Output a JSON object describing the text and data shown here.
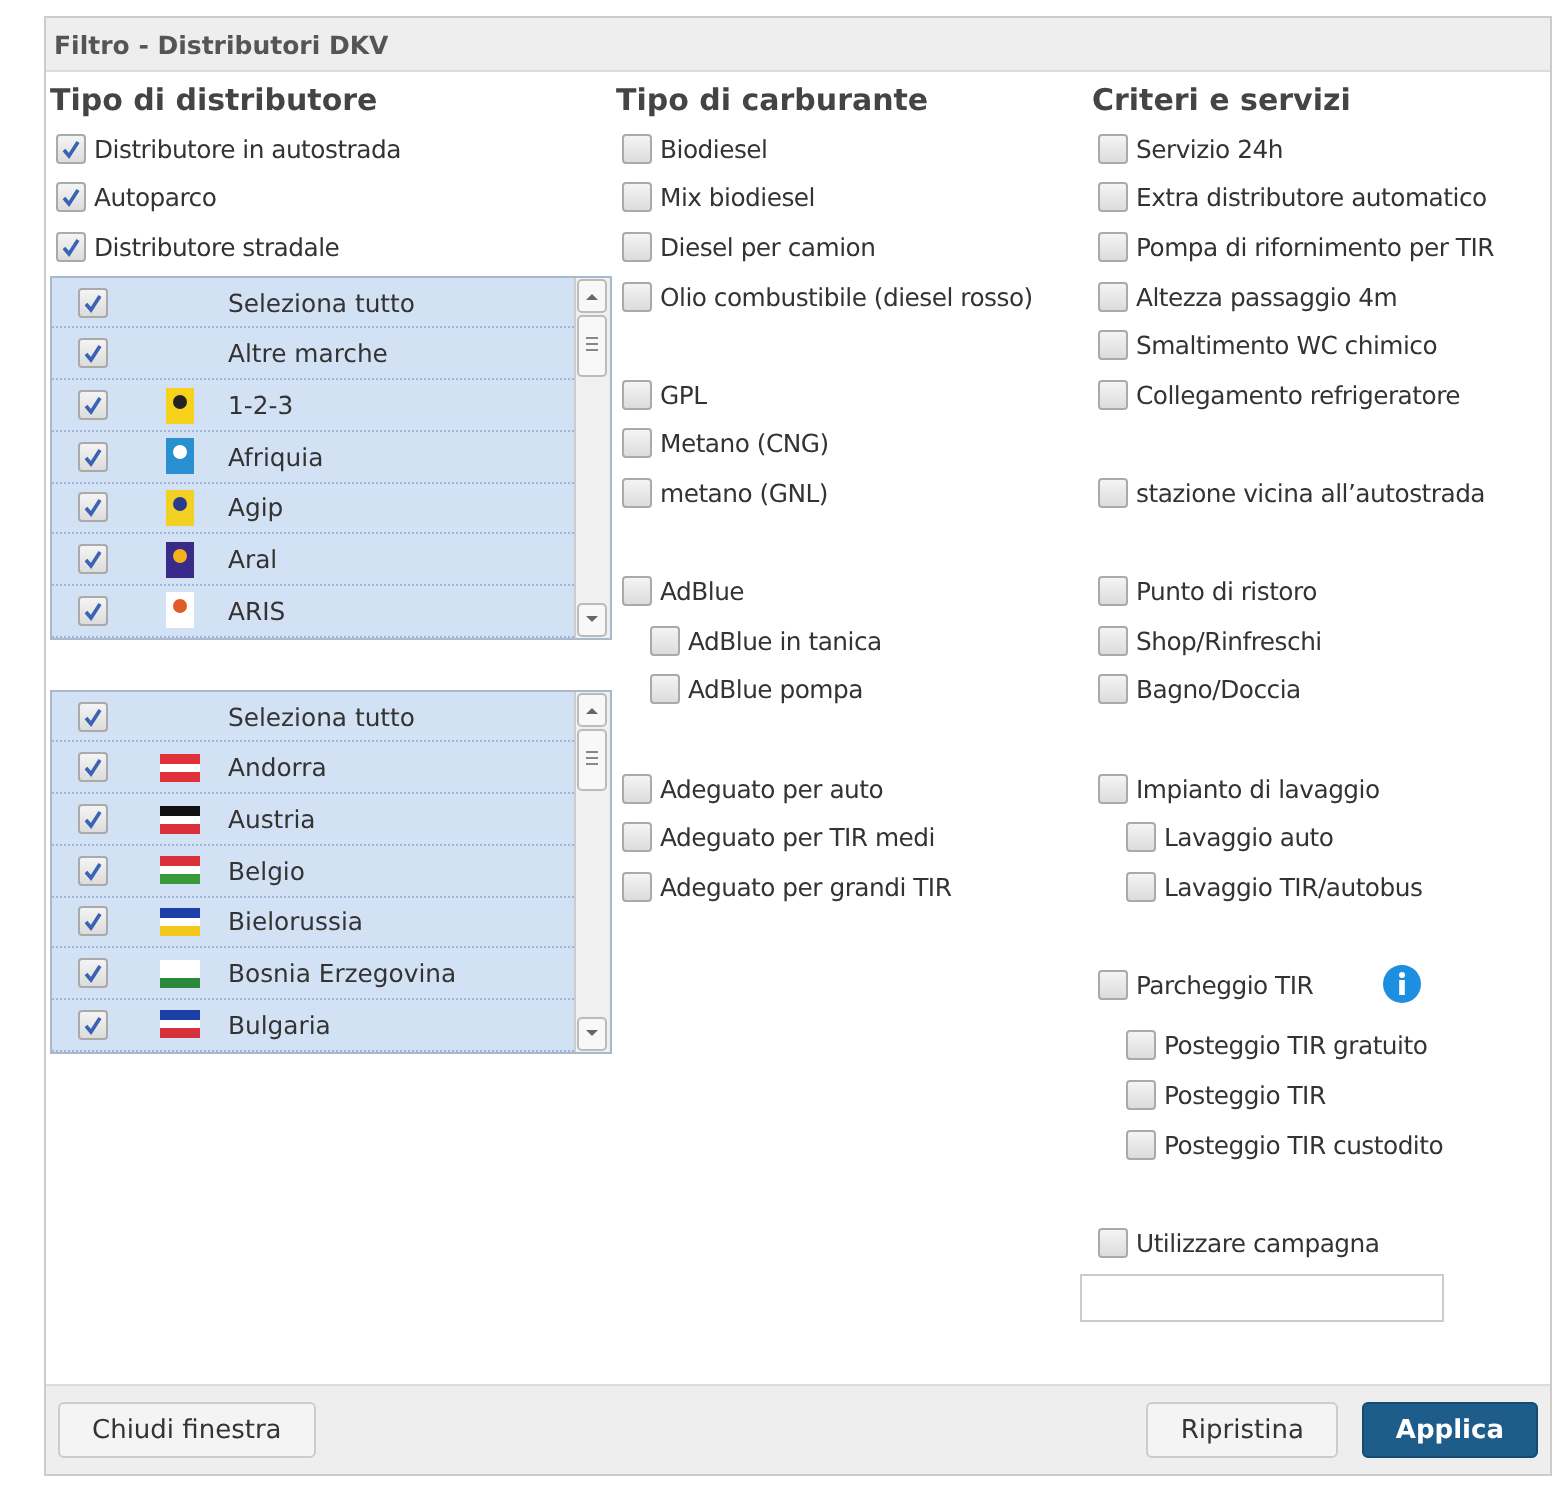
{
  "window": {
    "title": "Filtro - Distributori DKV"
  },
  "station_types": {
    "heading": "Tipo di distributore",
    "options": [
      {
        "label": "Distributore in autostrada",
        "checked": true
      },
      {
        "label": "Autoparco",
        "checked": true
      },
      {
        "label": "Distributore stradale",
        "checked": true
      }
    ]
  },
  "brands_list": [
    {
      "kind": "plain",
      "label": "Seleziona tutto",
      "checked": true
    },
    {
      "kind": "plain",
      "label": "Altre marche",
      "checked": true
    },
    {
      "kind": "logo",
      "label": "1-2-3",
      "checked": true
    },
    {
      "kind": "logo",
      "label": "Afriquia",
      "checked": true
    },
    {
      "kind": "logo",
      "label": "Agip",
      "checked": true
    },
    {
      "kind": "logo",
      "label": "Aral",
      "checked": true
    },
    {
      "kind": "logo",
      "label": "ARIS",
      "checked": true
    }
  ],
  "countries_list": [
    {
      "kind": "plain",
      "label": "Seleziona tutto",
      "checked": true
    },
    {
      "kind": "flag",
      "label": "Andorra",
      "checked": true
    },
    {
      "kind": "flag",
      "label": "Austria",
      "checked": true
    },
    {
      "kind": "flag",
      "label": "Belgio",
      "checked": true
    },
    {
      "kind": "flag",
      "label": "Bielorussia",
      "checked": true
    },
    {
      "kind": "flag",
      "label": "Bosnia Erzegovina",
      "checked": true
    },
    {
      "kind": "flag",
      "label": "Bulgaria",
      "checked": true
    }
  ],
  "fuel_types": {
    "heading": "Tipo di carburante",
    "groups": [
      [
        {
          "label": "Biodiesel",
          "checked": false
        },
        {
          "label": "Mix biodiesel",
          "checked": false
        },
        {
          "label": "Diesel per camion",
          "checked": false
        },
        {
          "label": "Olio combustibile (diesel rosso)",
          "checked": false
        }
      ],
      [
        {
          "label": "GPL",
          "checked": false
        },
        {
          "label": "Metano (CNG)",
          "checked": false
        },
        {
          "label": "metano (GNL)",
          "checked": false
        }
      ],
      [
        {
          "label": "AdBlue",
          "checked": false,
          "children": [
            {
              "label": "AdBlue in tanica",
              "checked": false
            },
            {
              "label": "AdBlue pompa",
              "checked": false
            }
          ]
        }
      ],
      [
        {
          "label": "Adeguato per auto",
          "checked": false
        },
        {
          "label": "Adeguato per TIR medi",
          "checked": false
        },
        {
          "label": "Adeguato per grandi TIR",
          "checked": false
        }
      ]
    ]
  },
  "services": {
    "heading": "Criteri e servizi",
    "groups": [
      [
        {
          "label": "Servizio 24h",
          "checked": false
        },
        {
          "label": "Extra distributore automatico",
          "checked": false
        },
        {
          "label": "Pompa di rifornimento per TIR",
          "checked": false
        },
        {
          "label": "Altezza passaggio 4m",
          "checked": false
        },
        {
          "label": "Smaltimento WC chimico",
          "checked": false
        },
        {
          "label": "Collegamento refrigeratore",
          "checked": false
        }
      ],
      [
        {
          "label": "stazione vicina all’autostrada",
          "checked": false
        }
      ],
      [
        {
          "label": "Punto di ristoro",
          "checked": false
        },
        {
          "label": "Shop/Rinfreschi",
          "checked": false
        },
        {
          "label": "Bagno/Doccia",
          "checked": false
        }
      ],
      [
        {
          "label": "Impianto di lavaggio",
          "checked": false,
          "children": [
            {
              "label": "Lavaggio auto",
              "checked": false
            },
            {
              "label": "Lavaggio TIR/autobus",
              "checked": false
            }
          ]
        }
      ],
      [
        {
          "label": "Parcheggio TIR",
          "checked": false,
          "info": true,
          "children": [
            {
              "label": "Posteggio TIR gratuito",
              "checked": false
            },
            {
              "label": "Posteggio TIR",
              "checked": false
            },
            {
              "label": "Posteggio TIR custodito",
              "checked": false
            }
          ]
        }
      ],
      [
        {
          "label": "Utilizzare campagna",
          "checked": false,
          "field": true
        }
      ]
    ]
  },
  "buttons": [
    {
      "kind": "secondary",
      "label": "Chiudi finestra"
    },
    {
      "kind": "secondary",
      "label": "Ripristina"
    },
    {
      "kind": "primary",
      "label": "Applica"
    }
  ]
}
